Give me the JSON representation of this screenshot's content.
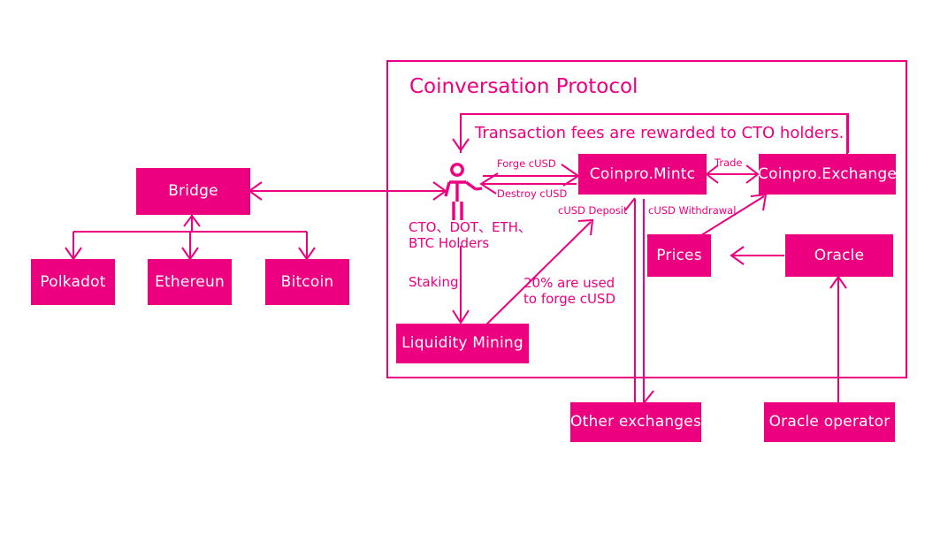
{
  "diagram": {
    "title": "Coinversation Protocol",
    "accent_color": "#EC0080",
    "background_color": "#FFFFFF"
  },
  "container": {
    "label": "Coinversation Protocol"
  },
  "nodes": {
    "bridge": "Bridge",
    "polkadot": "Polkadot",
    "ethereun": "Ethereun",
    "bitcoin": "Bitcoin",
    "coinpro_mintc": "Coinpro.Mintc",
    "coinpro_exchange": "Coinpro.Exchange",
    "prices": "Prices",
    "oracle": "Oracle",
    "liquidity_mining": "Liquidity Mining",
    "other_exchanges": "Other exchanges",
    "oracle_operator": "Oracle operator"
  },
  "labels": {
    "fees_note": "Transaction fees are rewarded to CTO holders.",
    "forge_cusd": "Forge cUSD",
    "destroy_cusd": "Destroy cUSD",
    "trade": "Trade",
    "cusd_deposit": "cUSD Deposit",
    "cusd_withdrawal": "cUSD Withdrawal",
    "holders_line1": "CTO、DOT、ETH、",
    "holders_line2": "BTC Holders",
    "staking": "Staking",
    "forge_note_line1": "20% are used",
    "forge_note_line2": "to forge cUSD"
  },
  "icons": {
    "person": "person-icon"
  }
}
